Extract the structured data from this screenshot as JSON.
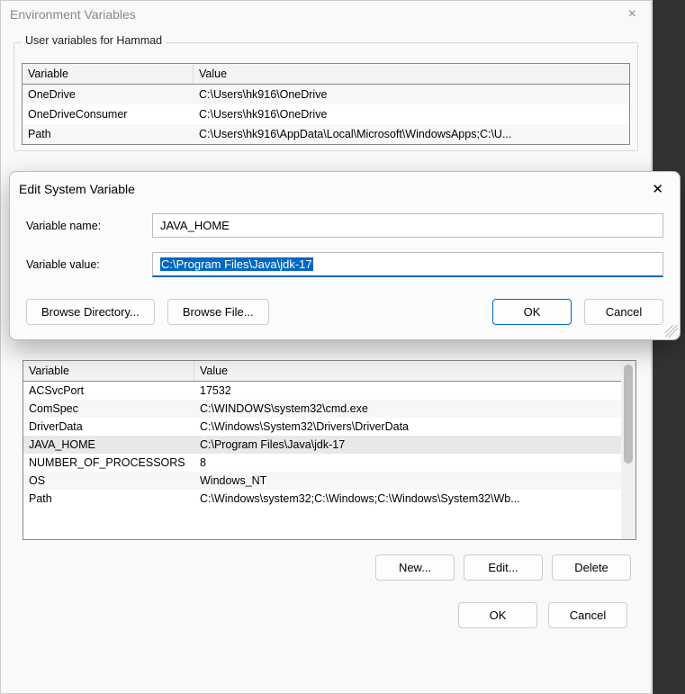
{
  "main": {
    "title": "Environment Variables",
    "close": "×",
    "user_group_label": "User variables for Hammad",
    "col_variable": "Variable",
    "col_value": "Value",
    "user_rows": [
      {
        "var": "OneDrive",
        "val": "C:\\Users\\hk916\\OneDrive"
      },
      {
        "var": "OneDriveConsumer",
        "val": "C:\\Users\\hk916\\OneDrive"
      },
      {
        "var": "Path",
        "val": "C:\\Users\\hk916\\AppData\\Local\\Microsoft\\WindowsApps;C:\\U..."
      }
    ],
    "system_rows": [
      {
        "var": "ACSvcPort",
        "val": "17532"
      },
      {
        "var": "ComSpec",
        "val": "C:\\WINDOWS\\system32\\cmd.exe"
      },
      {
        "var": "DriverData",
        "val": "C:\\Windows\\System32\\Drivers\\DriverData"
      },
      {
        "var": "JAVA_HOME",
        "val": "C:\\Program Files\\Java\\jdk-17"
      },
      {
        "var": "NUMBER_OF_PROCESSORS",
        "val": "8"
      },
      {
        "var": "OS",
        "val": "Windows_NT"
      },
      {
        "var": "Path",
        "val": "C:\\Windows\\system32;C:\\Windows;C:\\Windows\\System32\\Wb..."
      }
    ],
    "btn_new": "New...",
    "btn_edit": "Edit...",
    "btn_delete": "Delete",
    "btn_ok": "OK",
    "btn_cancel": "Cancel"
  },
  "edit": {
    "title": "Edit System Variable",
    "close": "✕",
    "label_name": "Variable name:",
    "label_value": "Variable value:",
    "val_name": "JAVA_HOME",
    "val_value": "C:\\Program Files\\Java\\jdk-17",
    "btn_browse_dir": "Browse Directory...",
    "btn_browse_file": "Browse File...",
    "btn_ok": "OK",
    "btn_cancel": "Cancel"
  }
}
